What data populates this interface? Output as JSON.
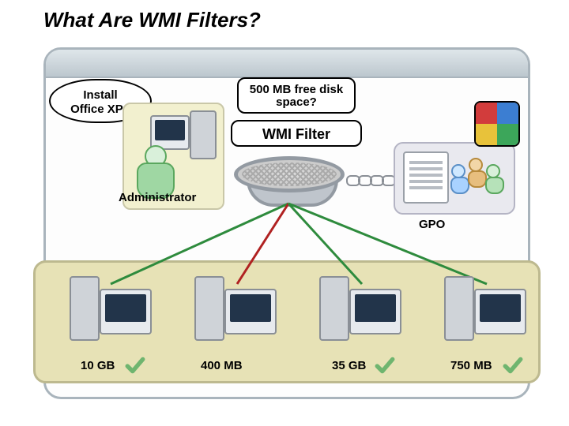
{
  "title": "What Are WMI Filters?",
  "bubble_text": "Install\nOffice XP?",
  "question_callout": "500 MB free disk space?",
  "filter_callout": "WMI Filter",
  "admin_label": "Administrator",
  "gpo_label": "GPO",
  "computers": [
    {
      "size_label": "10 GB",
      "passes": true
    },
    {
      "size_label": "400 MB",
      "passes": false
    },
    {
      "size_label": "35 GB",
      "passes": true
    },
    {
      "size_label": "750 MB",
      "passes": true
    }
  ],
  "icons": {
    "puzzle": "puzzle-icon",
    "sieve": "sieve-icon",
    "chain": "chain-icon",
    "check": "check-icon"
  }
}
